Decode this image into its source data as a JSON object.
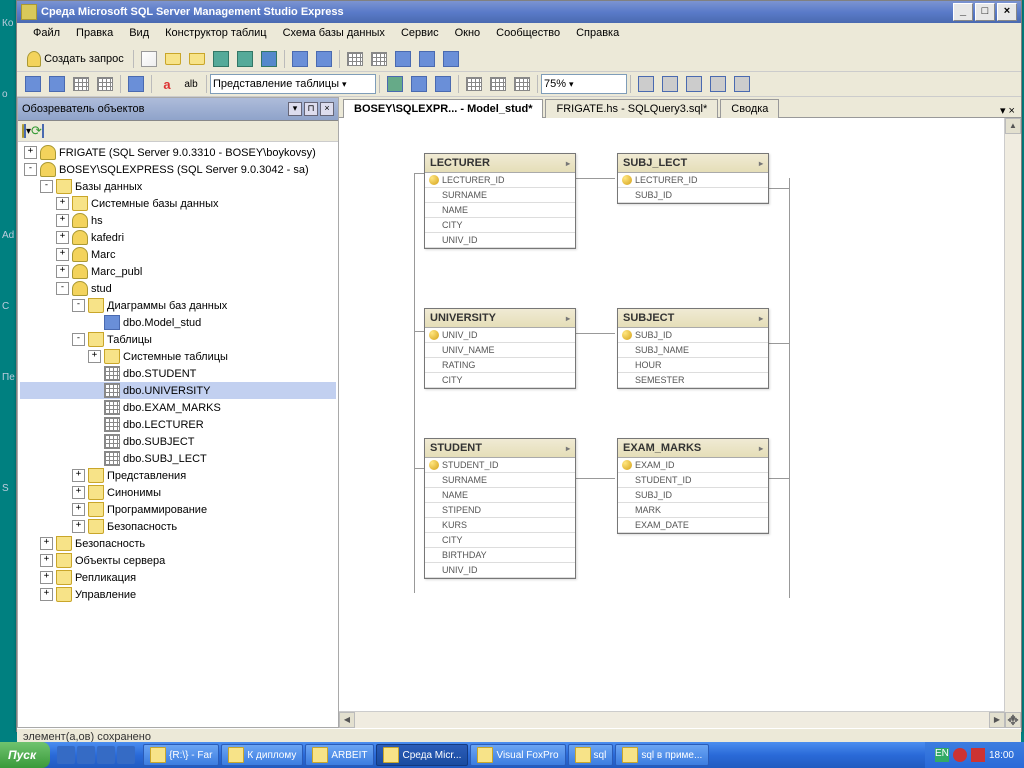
{
  "window": {
    "title": "Среда Microsoft SQL Server Management Studio Express"
  },
  "menu": [
    "Файл",
    "Правка",
    "Вид",
    "Конструктор таблиц",
    "Схема базы данных",
    "Сервис",
    "Окно",
    "Сообщество",
    "Справка"
  ],
  "toolbar1": {
    "new_query": "Создать запрос"
  },
  "toolbar2": {
    "view_combo": "Представление таблицы",
    "zoom": "75%"
  },
  "panel": {
    "title": "Обозреватель объектов"
  },
  "tree": {
    "n1": "FRIGATE (SQL Server 9.0.3310 - BOSEY\\boykovsy)",
    "n2": "BOSEY\\SQLEXPRESS (SQL Server 9.0.3042 - sa)",
    "n3": "Базы данных",
    "n4": "Системные базы данных",
    "n5": "hs",
    "n6": "kafedri",
    "n7": "Marc",
    "n8": "Marc_publ",
    "n9": "stud",
    "n10": "Диаграммы баз данных",
    "n11": "dbo.Model_stud",
    "n12": "Таблицы",
    "n13": "Системные таблицы",
    "n14": "dbo.STUDENT",
    "n15": "dbo.UNIVERSITY",
    "n16": "dbo.EXAM_MARKS",
    "n17": "dbo.LECTURER",
    "n18": "dbo.SUBJECT",
    "n19": "dbo.SUBJ_LECT",
    "n20": "Представления",
    "n21": "Синонимы",
    "n22": "Программирование",
    "n23": "Безопасность",
    "n24": "Безопасность",
    "n25": "Объекты сервера",
    "n26": "Репликация",
    "n27": "Управление"
  },
  "tabs": {
    "t1": "BOSEY\\SQLEXPR... - Model_stud*",
    "t2": "FRIGATE.hs - SQLQuery3.sql*",
    "t3": "Сводка"
  },
  "tables": {
    "LECTURER": {
      "title": "LECTURER",
      "cols": [
        "LECTURER_ID",
        "SURNAME",
        "NAME",
        "CITY",
        "UNIV_ID"
      ],
      "pk": [
        0
      ]
    },
    "SUBJ_LECT": {
      "title": "SUBJ_LECT",
      "cols": [
        "LECTURER_ID",
        "SUBJ_ID"
      ],
      "pk": [
        0
      ]
    },
    "UNIVERSITY": {
      "title": "UNIVERSITY",
      "cols": [
        "UNIV_ID",
        "UNIV_NAME",
        "RATING",
        "CITY"
      ],
      "pk": [
        0
      ]
    },
    "SUBJECT": {
      "title": "SUBJECT",
      "cols": [
        "SUBJ_ID",
        "SUBJ_NAME",
        "HOUR",
        "SEMESTER"
      ],
      "pk": [
        0
      ]
    },
    "STUDENT": {
      "title": "STUDENT",
      "cols": [
        "STUDENT_ID",
        "SURNAME",
        "NAME",
        "STIPEND",
        "KURS",
        "CITY",
        "BIRTHDAY",
        "UNIV_ID"
      ],
      "pk": [
        0
      ]
    },
    "EXAM_MARKS": {
      "title": "EXAM_MARKS",
      "cols": [
        "EXAM_ID",
        "STUDENT_ID",
        "SUBJ_ID",
        "MARK",
        "EXAM_DATE"
      ],
      "pk": [
        0
      ]
    }
  },
  "statusbar": "элемент(а,ов) сохранено",
  "taskbar": {
    "start": "Пуск",
    "items": [
      "{R:\\} - Far",
      "К диплому",
      "ARBEIT",
      "Среда Micr...",
      "Visual FoxPro",
      "sql",
      "sql в приме..."
    ],
    "lang": "EN",
    "time": "18:00"
  },
  "leftlabels": [
    "Ко",
    "о",
    "Ad",
    "С",
    "Пе",
    "S"
  ]
}
